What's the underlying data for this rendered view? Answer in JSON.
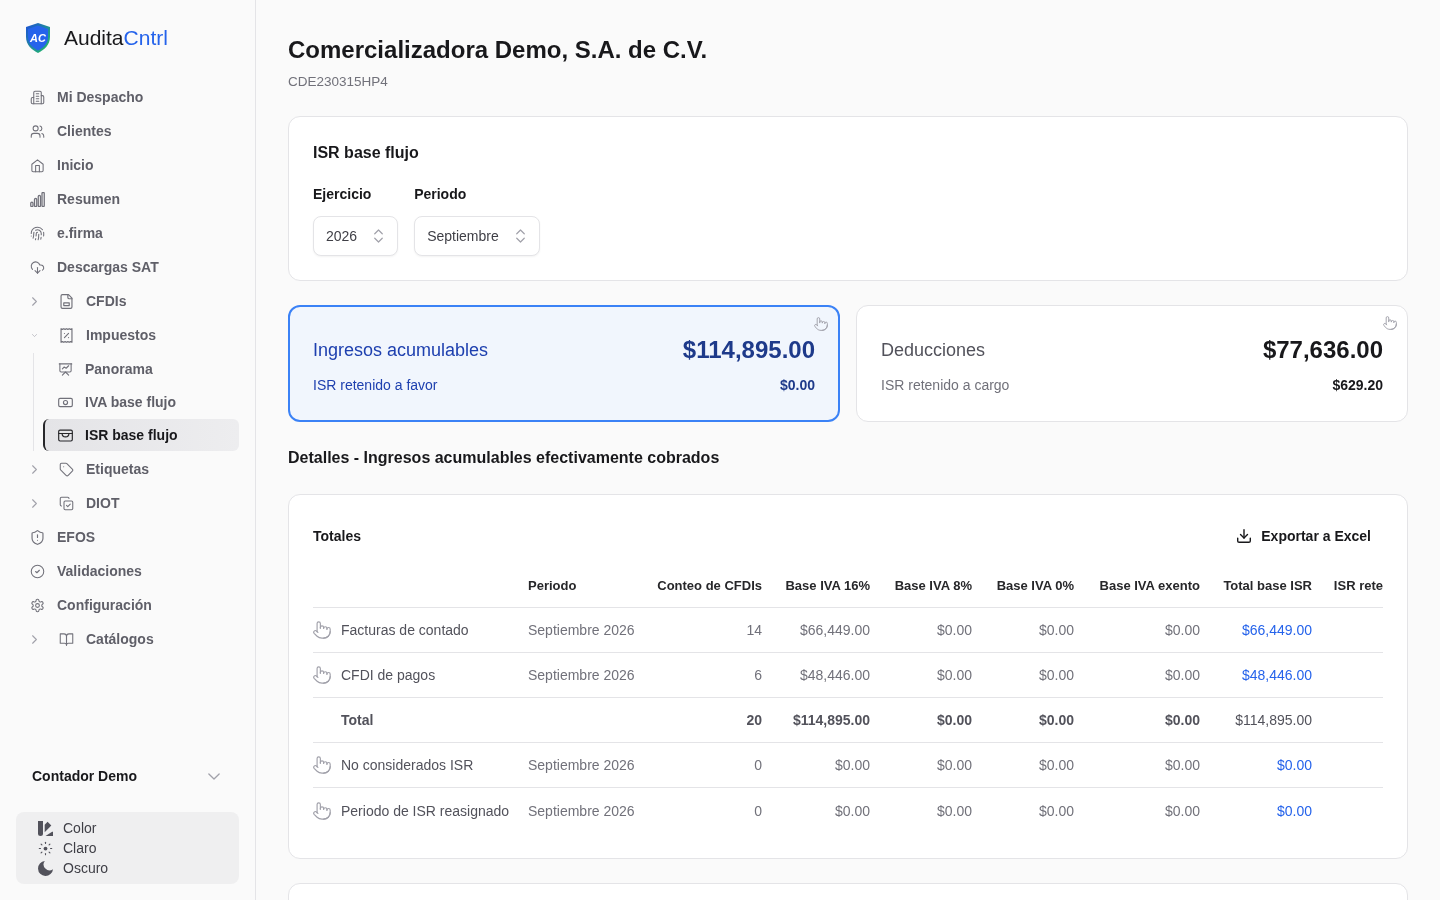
{
  "sidebar": {
    "brand": {
      "mark": "AC",
      "name": "Audita",
      "accent": "Cntrl"
    },
    "items": [
      {
        "label": "Mi Despacho",
        "kind": "link",
        "selected": false
      },
      {
        "label": "Clientes",
        "kind": "link",
        "selected": false
      },
      {
        "label": "Inicio",
        "kind": "link",
        "selected": false
      },
      {
        "label": "Resumen",
        "kind": "link",
        "selected": false
      },
      {
        "label": "e.firma",
        "kind": "link",
        "selected": false
      },
      {
        "label": "Descargas SAT",
        "kind": "link",
        "selected": false
      },
      {
        "label": "CFDIs",
        "kind": "group",
        "expanded": false,
        "selected": false
      },
      {
        "label": "Impuestos",
        "kind": "group",
        "expanded": true,
        "selected": false,
        "children": [
          {
            "label": "Panorama",
            "selected": false
          },
          {
            "label": "IVA base flujo",
            "selected": false
          },
          {
            "label": "ISR base flujo",
            "selected": true
          }
        ]
      },
      {
        "label": "Etiquetas",
        "kind": "group",
        "expanded": false,
        "selected": false
      },
      {
        "label": "DIOT",
        "kind": "group",
        "expanded": false,
        "selected": false
      },
      {
        "label": "EFOS",
        "kind": "link",
        "selected": false
      },
      {
        "label": "Validaciones",
        "kind": "link",
        "selected": false
      },
      {
        "label": "Configuración",
        "kind": "link",
        "selected": false
      },
      {
        "label": "Catálogos",
        "kind": "group",
        "expanded": false,
        "selected": false
      }
    ],
    "user": {
      "name": "Contador Demo"
    },
    "theme_options": [
      {
        "label": "Color",
        "selected": false
      },
      {
        "label": "Claro",
        "selected": false
      },
      {
        "label": "Oscuro",
        "selected": false
      }
    ]
  },
  "header": {
    "title": "Comercializadora Demo, S.A. de C.V.",
    "subtitle": "CDE230315HP4"
  },
  "filter_card": {
    "title": "ISR base flujo",
    "fields": [
      {
        "label": "Ejercicio",
        "value": "2026"
      },
      {
        "label": "Periodo",
        "value": "Septiembre"
      }
    ]
  },
  "summary_cards": [
    {
      "title": "Ingresos acumulables",
      "amount": "$114,895.00",
      "sub_label": "ISR retenido a favor",
      "sub_amount": "$0.00",
      "selected": true
    },
    {
      "title": "Deducciones",
      "amount": "$77,636.00",
      "sub_label": "ISR retenido a cargo",
      "sub_amount": "$629.20",
      "selected": false
    }
  ],
  "details": {
    "heading": "Detalles - Ingresos acumulables efectivamente cobrados",
    "title": "Totales",
    "export_button": "Exportar a Excel",
    "columns": [
      {
        "label": "Periodo",
        "kind": "text"
      },
      {
        "label": "Conteo de CFDIs",
        "kind": "number"
      },
      {
        "label": "Base IVA 16%",
        "kind": "number"
      },
      {
        "label": "Base IVA 8%",
        "kind": "number"
      },
      {
        "label": "Base IVA 0%",
        "kind": "number"
      },
      {
        "label": "Base IVA exento",
        "kind": "number"
      },
      {
        "label": "Total base ISR",
        "kind": "link"
      },
      {
        "label": "ISR rete",
        "kind": "number"
      }
    ],
    "rows": [
      {
        "kind": "data",
        "label": "Facturas de contado",
        "cells": [
          "Septiembre 2026",
          "14",
          "$66,449.00",
          "$0.00",
          "$0.00",
          "$0.00",
          "$66,449.00"
        ]
      },
      {
        "kind": "data",
        "label": "CFDI de pagos",
        "cells": [
          "Septiembre 2026",
          "6",
          "$48,446.00",
          "$0.00",
          "$0.00",
          "$0.00",
          "$48,446.00"
        ]
      },
      {
        "kind": "total",
        "label": "Total",
        "cells": [
          "",
          "20",
          "$114,895.00",
          "$0.00",
          "$0.00",
          "$0.00",
          "$114,895.00"
        ]
      },
      {
        "kind": "data",
        "label": "No considerados ISR",
        "cells": [
          "Septiembre 2026",
          "0",
          "$0.00",
          "$0.00",
          "$0.00",
          "$0.00",
          "$0.00"
        ]
      },
      {
        "kind": "data",
        "label": "Periodo de ISR reasignado",
        "cells": [
          "Septiembre 2026",
          "0",
          "$0.00",
          "$0.00",
          "$0.00",
          "$0.00",
          "$0.00"
        ]
      }
    ]
  }
}
